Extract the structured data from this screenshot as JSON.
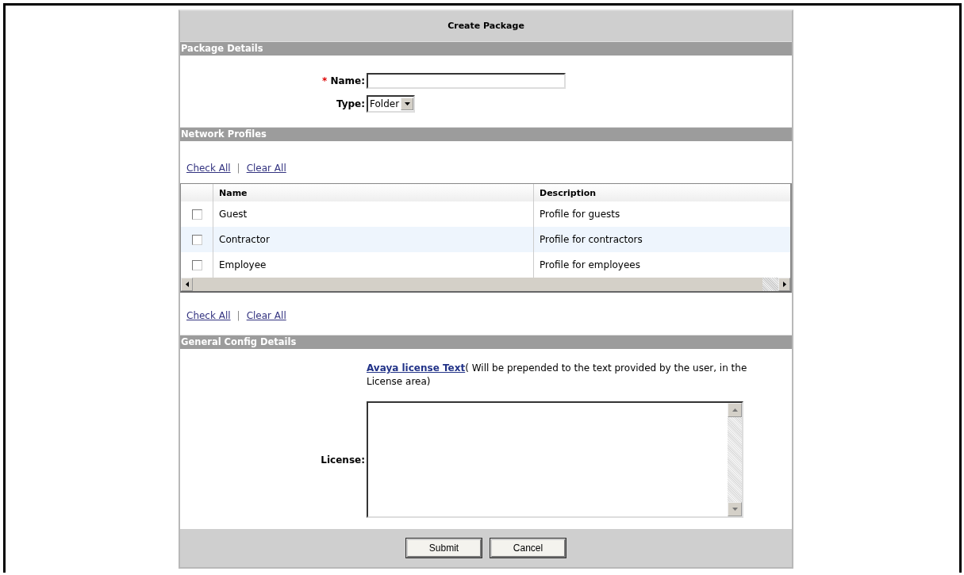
{
  "title": "Create Package",
  "sections": [
    {
      "kind": "details",
      "title": "Package Details"
    },
    {
      "kind": "profiles",
      "title": "Network Profiles"
    },
    {
      "kind": "config",
      "title": "General Config Details"
    }
  ],
  "package": {
    "name_required": "*",
    "name_label": "Name:",
    "type_label": "Type:",
    "type_value": "Folder"
  },
  "links": [
    "Check All",
    "|",
    "Clear All"
  ],
  "links_bottom": [
    "Check All",
    "|",
    "Clear All"
  ],
  "table": {
    "columns": [
      "Name",
      "Description"
    ],
    "rows": [
      {
        "checked": false,
        "selected": false,
        "cells": [
          "Guest",
          "Profile for guests"
        ]
      },
      {
        "checked": false,
        "selected": true,
        "cells": [
          "Contractor",
          "Profile for contractors"
        ]
      },
      {
        "checked": false,
        "selected": false,
        "cells": [
          "Employee",
          "Profile for employees"
        ]
      }
    ]
  },
  "config": {
    "link": "Avaya license Text",
    "note": "( Will be prepended to the text provided by the user, in the License area)",
    "license_label": "License:"
  },
  "buttons": [
    "Submit",
    "Cancel"
  ]
}
